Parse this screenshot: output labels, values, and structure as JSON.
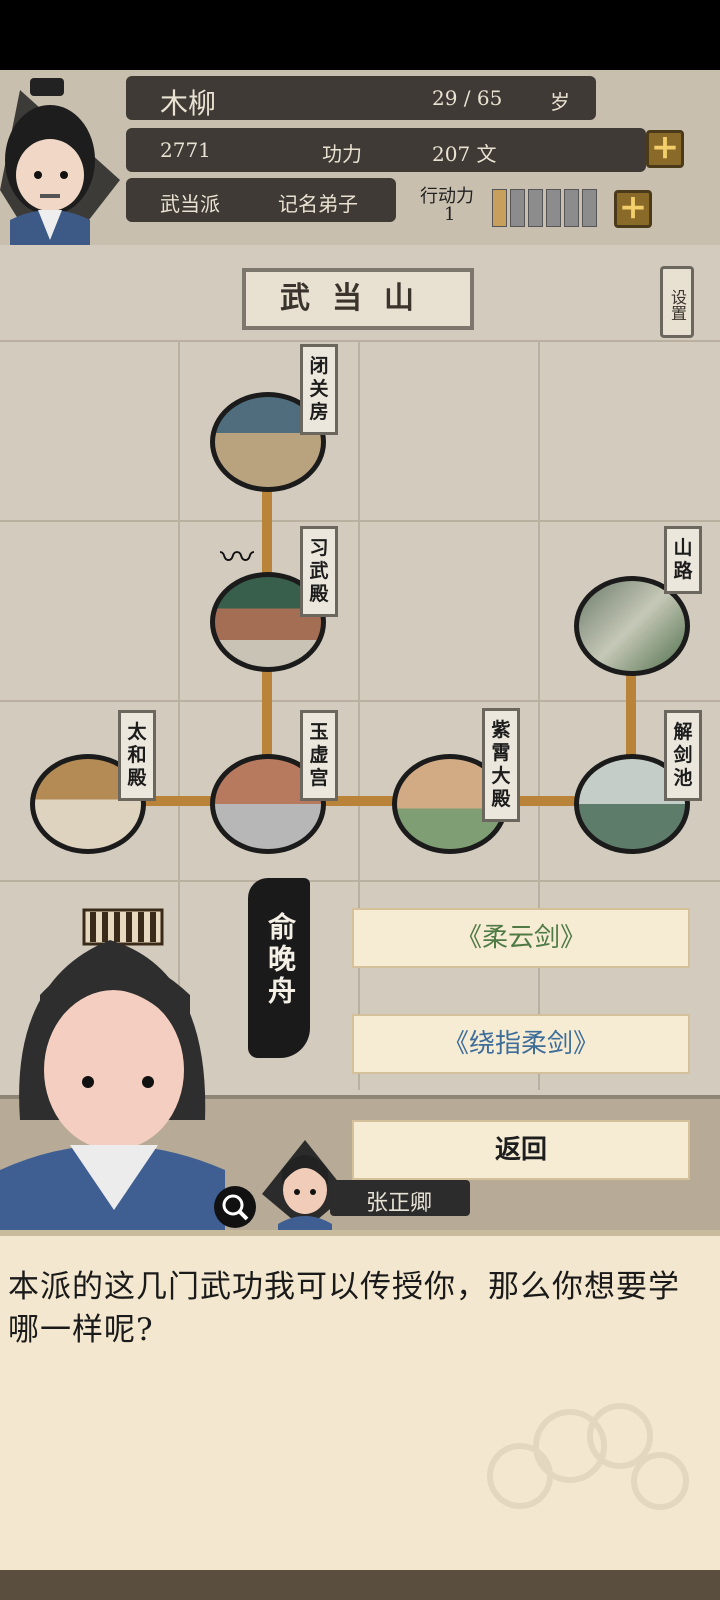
{
  "player": {
    "name": "木柳",
    "age": "29 / 65",
    "age_unit": "岁",
    "power_value": "2771",
    "power_label": "功力",
    "money": "207 文",
    "sect": "武当派",
    "rank": "记名弟子",
    "action_label": "行动力",
    "action_value": "1",
    "action_bar_filled_fraction": 0.17
  },
  "map": {
    "title": "武当山",
    "settings_label": "设置",
    "locations": [
      {
        "id": "biguanfang",
        "label": "闭关房"
      },
      {
        "id": "xiwudian",
        "label": "习武殿"
      },
      {
        "id": "shanlu",
        "label": "山路"
      },
      {
        "id": "taihedian",
        "label": "太和殿"
      },
      {
        "id": "yuxugong",
        "label": "玉虚宫"
      },
      {
        "id": "zixiaodadian",
        "label": "紫霄大殿"
      },
      {
        "id": "jiejianchi",
        "label": "解剑池"
      }
    ]
  },
  "npc": {
    "name": "俞晚舟",
    "secondary_name": "张正卿"
  },
  "choices": [
    {
      "label": "《柔云剑》",
      "color": "#4f7a45"
    },
    {
      "label": "《绕指柔剑》",
      "color": "#3e6d9a"
    },
    {
      "label": "返回",
      "color": "#1e1e1e"
    }
  ],
  "dialog": {
    "text": "本派的这几门武功我可以传授你，那么你想要学哪一样呢?"
  }
}
